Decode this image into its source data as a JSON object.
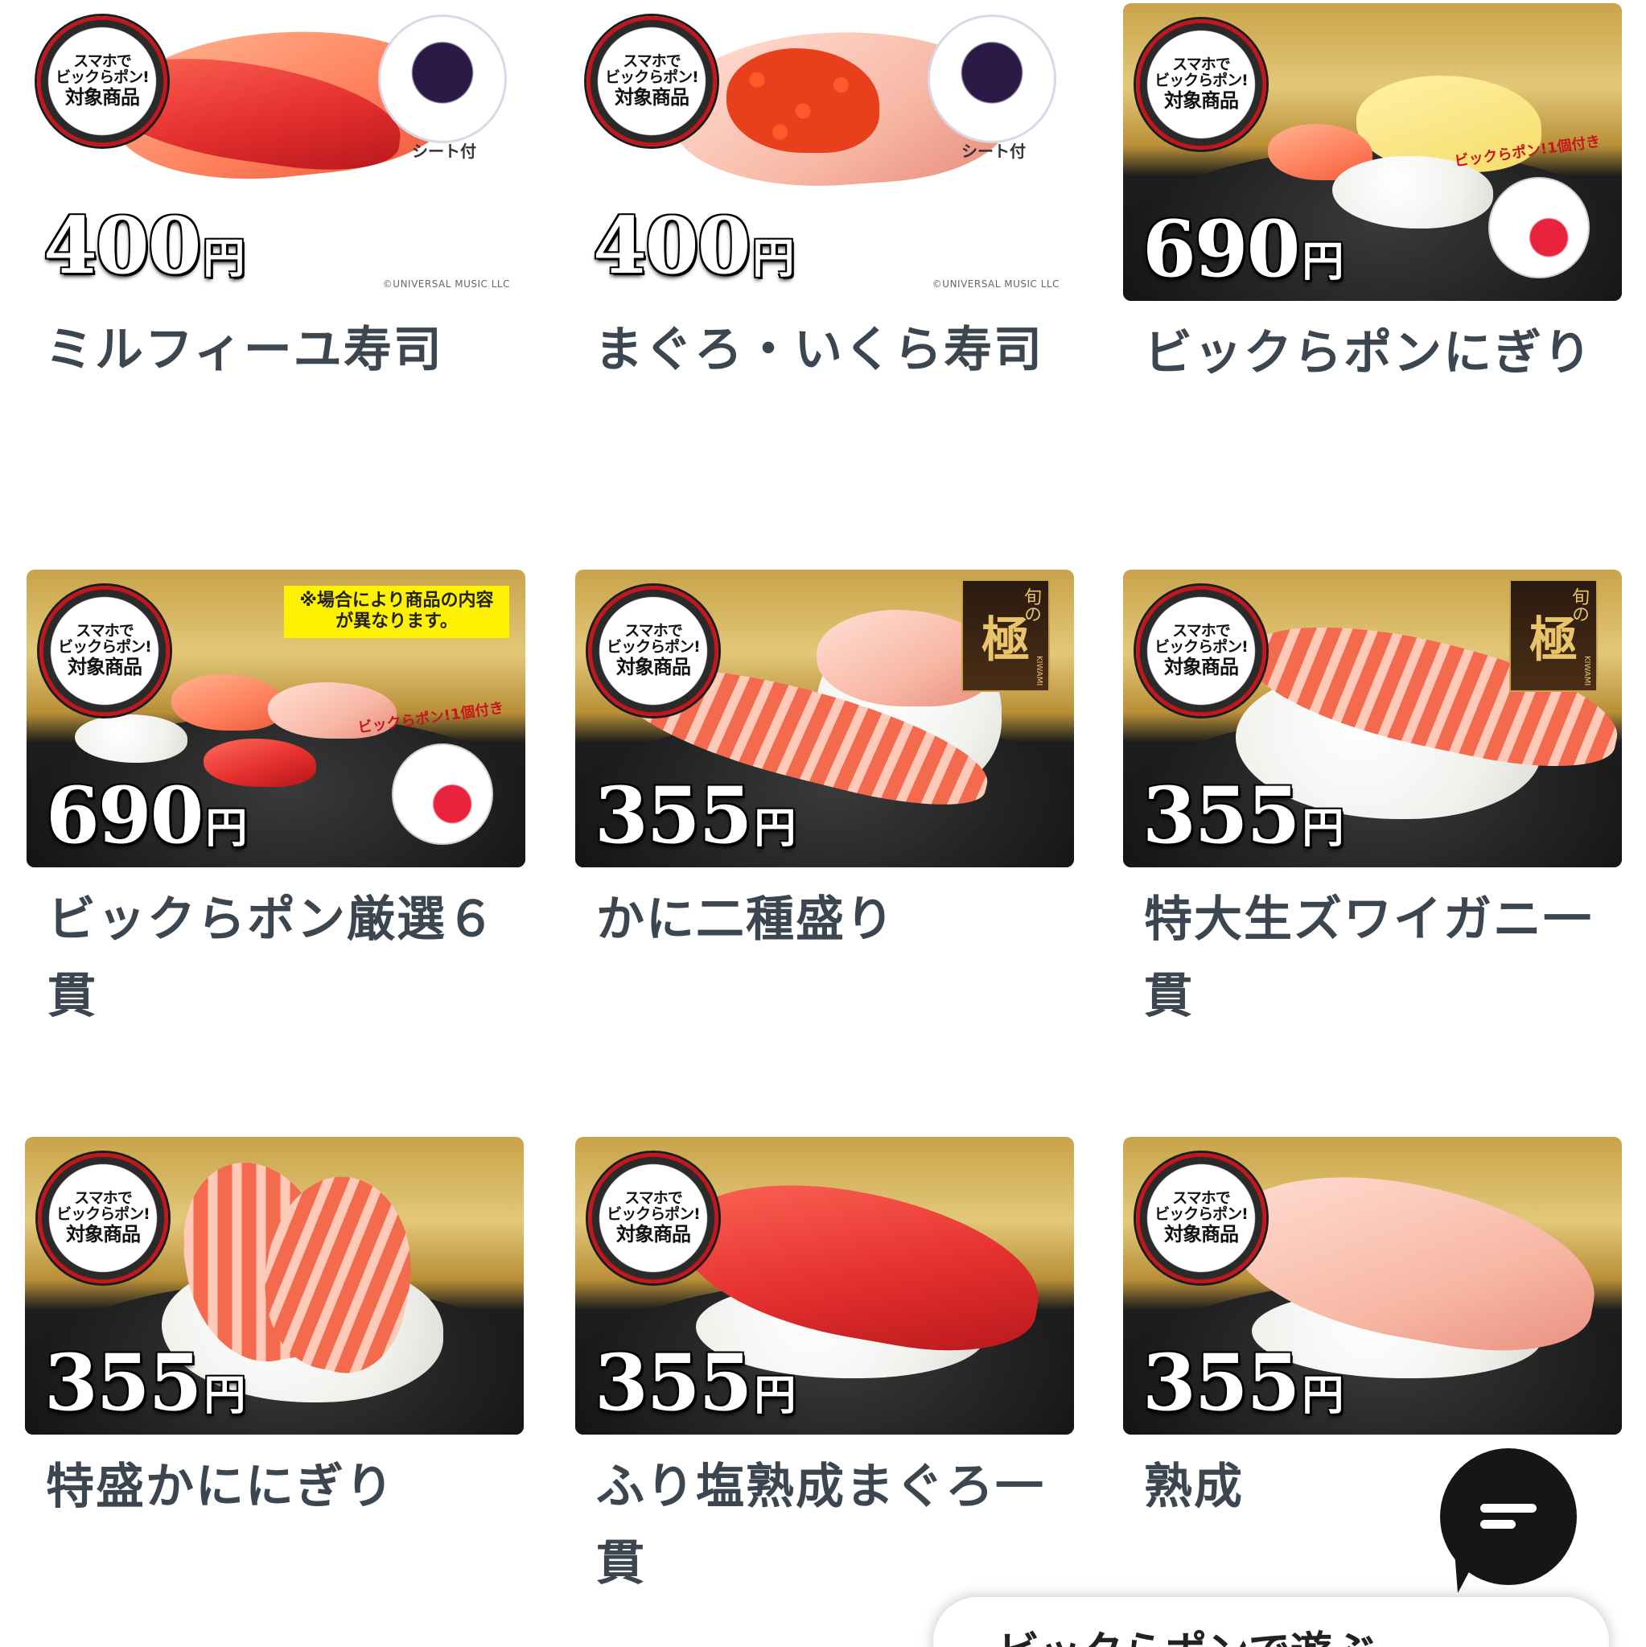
{
  "badge": {
    "line1": "スマホで",
    "line2": "ビックらポン!",
    "line3": "対象商品"
  },
  "sheet_label": "シート付",
  "copyright": "©UNIVERSAL MUSIC LLC",
  "capsule_tag": "ビックらポン!1個付き",
  "notice": "※場合により商品の内容が異なります。",
  "kiwami": {
    "main": "極",
    "side": "旬の",
    "en": "KIWAMI"
  },
  "yen": "円",
  "items": [
    {
      "name": "ミルフィーユ寿司",
      "price": "400"
    },
    {
      "name": "まぐろ・いくら寿司",
      "price": "400"
    },
    {
      "name": "ビックらポンにぎり",
      "price": "690"
    },
    {
      "name": "ビックらポン厳選６貫",
      "price": "690"
    },
    {
      "name": "かに二種盛り",
      "price": "355"
    },
    {
      "name": "特大生ズワイガニ一貫",
      "price": "355"
    },
    {
      "name": "特盛かににぎり",
      "price": "355"
    },
    {
      "name": "ふり塩熟成まぐろ一貫",
      "price": "355"
    },
    {
      "name": "熟成",
      "price": "355"
    }
  ],
  "bottom_button": "ビックらポンで遊ぶ",
  "colors": {
    "name_text": "#3c4650",
    "badge_ring": "#c4161c",
    "notice_bg": "#fff200"
  }
}
